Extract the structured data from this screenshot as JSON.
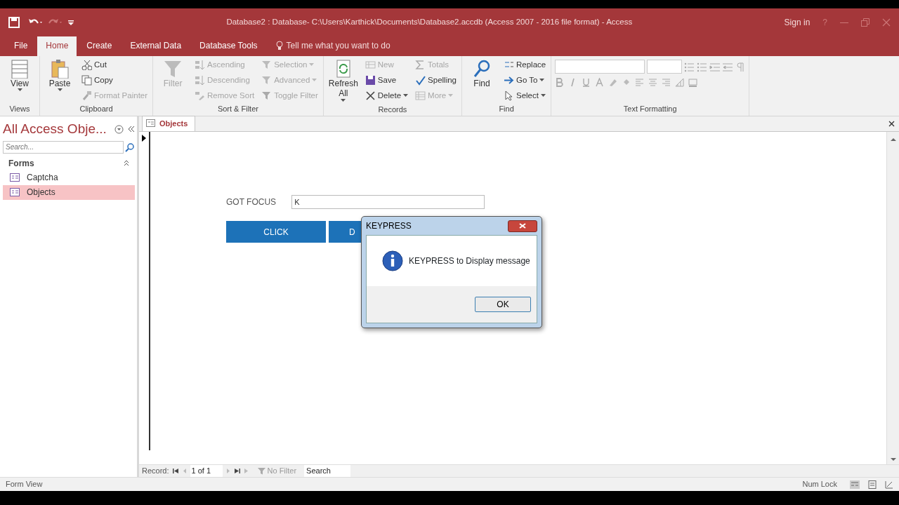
{
  "title_bar": {
    "title": "Database2 : Database- C:\\Users\\Karthick\\Documents\\Database2.accdb (Access 2007 - 2016 file format)  -  Access",
    "sign_in": "Sign in",
    "help": "?"
  },
  "ribbon_tabs": [
    {
      "label": "File",
      "selected": false
    },
    {
      "label": "Home",
      "selected": true
    },
    {
      "label": "Create",
      "selected": false
    },
    {
      "label": "External Data",
      "selected": false
    },
    {
      "label": "Database Tools",
      "selected": false
    }
  ],
  "tell_me": "Tell me what you want to do",
  "ribbon_groups": [
    {
      "label": "Views",
      "kind": "buttons",
      "columns": [
        [
          {
            "label": "View",
            "kind": "large",
            "disabled": false,
            "dropdown": true
          }
        ]
      ]
    },
    {
      "label": "Clipboard",
      "kind": "buttons",
      "columns": [
        [
          {
            "label": "Paste",
            "kind": "large",
            "disabled": false,
            "dropdown": true
          }
        ],
        [
          {
            "label": "Cut",
            "kind": "small",
            "disabled": false,
            "dropdown": false
          },
          {
            "label": "Copy",
            "kind": "small",
            "disabled": false,
            "dropdown": false
          },
          {
            "label": "Format Painter",
            "kind": "small",
            "disabled": true,
            "dropdown": false
          }
        ]
      ]
    },
    {
      "label": "Sort & Filter",
      "kind": "buttons",
      "columns": [
        [
          {
            "label": "Filter",
            "kind": "large",
            "disabled": true,
            "dropdown": false
          }
        ],
        [
          {
            "label": "Ascending",
            "kind": "small",
            "disabled": true,
            "dropdown": false
          },
          {
            "label": "Descending",
            "kind": "small",
            "disabled": true,
            "dropdown": false
          },
          {
            "label": "Remove Sort",
            "kind": "small",
            "disabled": true,
            "dropdown": false
          }
        ],
        [
          {
            "label": "Selection",
            "kind": "small",
            "disabled": true,
            "dropdown": true
          },
          {
            "label": "Advanced",
            "kind": "small",
            "disabled": true,
            "dropdown": true
          },
          {
            "label": "Toggle Filter",
            "kind": "small",
            "disabled": true,
            "dropdown": false
          }
        ]
      ]
    },
    {
      "label": "Records",
      "kind": "buttons",
      "columns": [
        [
          {
            "label": "Refresh All",
            "kind": "large",
            "disabled": false,
            "dropdown": true
          }
        ],
        [
          {
            "label": "New",
            "kind": "small",
            "disabled": true,
            "dropdown": false
          },
          {
            "label": "Save",
            "kind": "small",
            "disabled": false,
            "dropdown": false
          },
          {
            "label": "Delete",
            "kind": "small",
            "disabled": false,
            "dropdown": true
          }
        ],
        [
          {
            "label": "Totals",
            "kind": "small",
            "disabled": true,
            "dropdown": false
          },
          {
            "label": "Spelling",
            "kind": "small",
            "disabled": false,
            "dropdown": false
          },
          {
            "label": "More",
            "kind": "small",
            "disabled": true,
            "dropdown": true
          }
        ]
      ]
    },
    {
      "label": "Find",
      "kind": "buttons",
      "columns": [
        [
          {
            "label": "Find",
            "kind": "large",
            "disabled": false,
            "dropdown": false
          }
        ],
        [
          {
            "label": "Replace",
            "kind": "small",
            "disabled": false,
            "dropdown": false
          },
          {
            "label": "Go To",
            "kind": "small",
            "disabled": false,
            "dropdown": true
          },
          {
            "label": "Select",
            "kind": "small",
            "disabled": false,
            "dropdown": true
          }
        ]
      ]
    },
    {
      "label": "Text Formatting",
      "kind": "formatting"
    }
  ],
  "nav_pane": {
    "title": "All Access Obje...",
    "search_placeholder": "Search...",
    "sections": [
      {
        "label": "Forms",
        "expanded": true,
        "items": [
          {
            "label": "Captcha",
            "selected": false
          },
          {
            "label": "Objects",
            "selected": true
          }
        ]
      }
    ]
  },
  "document_tabs": [
    {
      "label": "Objects",
      "selected": true
    }
  ],
  "form": {
    "label": "GOT FOCUS",
    "field_value": "K",
    "buttons": [
      {
        "label": "CLICK",
        "cut_off": false
      },
      {
        "label": "D",
        "cut_off": true
      }
    ]
  },
  "dialog": {
    "title": "KEYPRESS",
    "message": "KEYPRESS to Display message",
    "button": "OK"
  },
  "record_nav": {
    "label": "Record:",
    "position": "1 of 1",
    "filter": "No Filter",
    "search": "Search"
  },
  "status_bar": {
    "left": "Form View",
    "right": "Num Lock"
  }
}
